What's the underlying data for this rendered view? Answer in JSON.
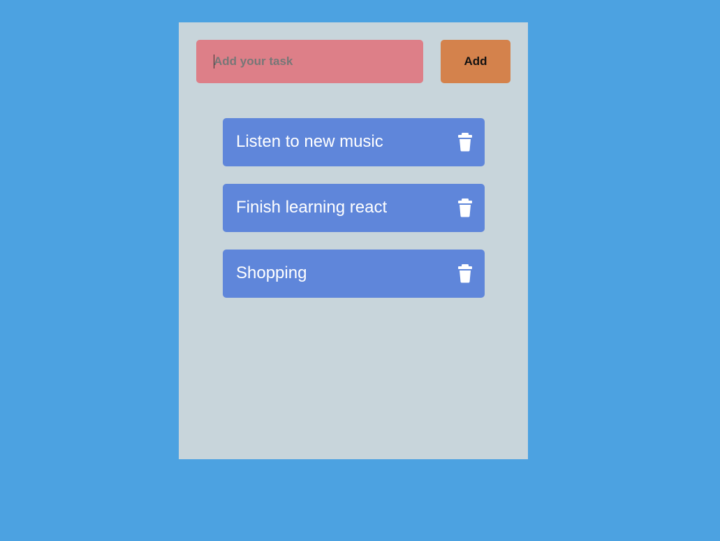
{
  "colors": {
    "background": "#4ca2e1",
    "panel": "#c8d5db",
    "input_bg": "#dd7f88",
    "add_button_bg": "#d4824c",
    "task_bg": "#5f86da",
    "task_text": "#ffffff"
  },
  "form": {
    "input_placeholder": "Add your task",
    "input_value": "",
    "add_label": "Add"
  },
  "tasks": [
    {
      "label": "Listen to new music",
      "icon": "trash-icon"
    },
    {
      "label": "Finish learning react",
      "icon": "trash-icon"
    },
    {
      "label": "Shopping",
      "icon": "trash-icon"
    }
  ]
}
